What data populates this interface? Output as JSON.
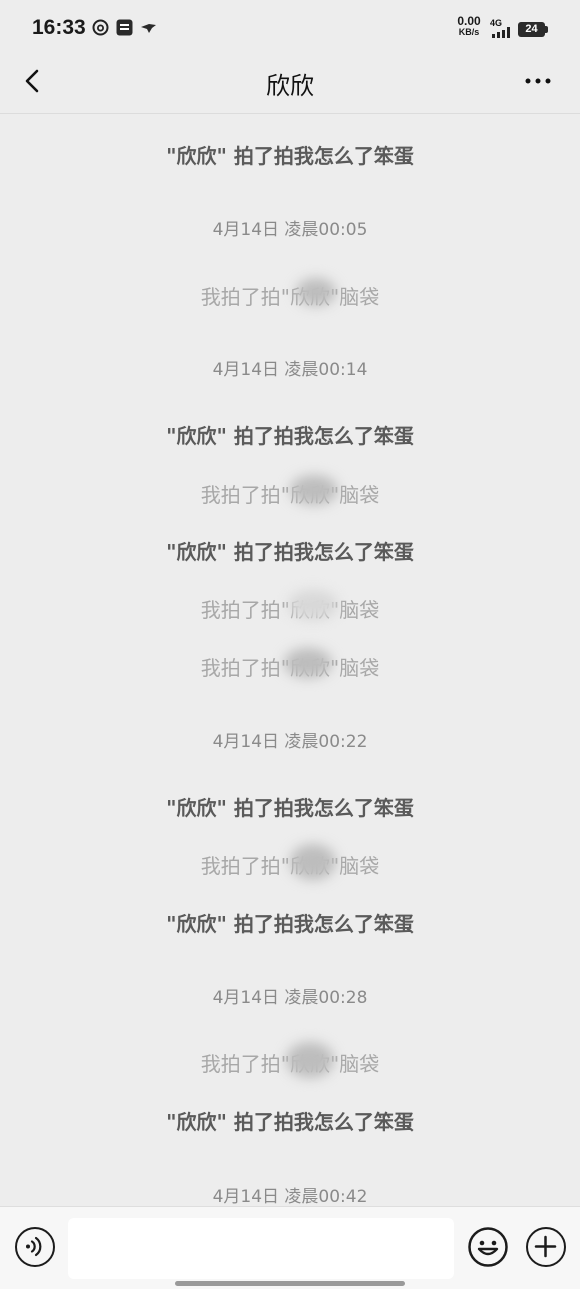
{
  "status_bar": {
    "time": "16:33",
    "net_speed_value": "0.00",
    "net_speed_unit": "KB/s",
    "network": "4G",
    "battery": "24"
  },
  "header": {
    "title": "欣欣",
    "back_icon": "chevron-left-icon",
    "more_icon": "more-dots-icon"
  },
  "messages": [
    {
      "type": "pat",
      "text": "\"欣欣\" 拍了拍我怎么了笨蛋"
    },
    {
      "type": "time",
      "text": "4月14日 凌晨00:05"
    },
    {
      "type": "self",
      "text": "我拍了拍\"欣欣\"脑袋"
    },
    {
      "type": "time",
      "text": "4月14日 凌晨00:14"
    },
    {
      "type": "pat",
      "text": "\"欣欣\" 拍了拍我怎么了笨蛋"
    },
    {
      "type": "self",
      "text": "我拍了拍\"欣欣\"脑袋"
    },
    {
      "type": "pat",
      "text": "\"欣欣\" 拍了拍我怎么了笨蛋"
    },
    {
      "type": "self",
      "text": "我拍了拍\"欣欣\"脑袋"
    },
    {
      "type": "self",
      "text": "我拍了拍\"欣欣\"脑袋"
    },
    {
      "type": "time",
      "text": "4月14日 凌晨00:22"
    },
    {
      "type": "pat",
      "text": "\"欣欣\" 拍了拍我怎么了笨蛋"
    },
    {
      "type": "self",
      "text": "我拍了拍\"欣欣\"脑袋"
    },
    {
      "type": "pat",
      "text": "\"欣欣\" 拍了拍我怎么了笨蛋"
    },
    {
      "type": "time",
      "text": "4月14日 凌晨00:28"
    },
    {
      "type": "self",
      "text": "我拍了拍\"欣欣\"脑袋"
    },
    {
      "type": "pat",
      "text": "\"欣欣\" 拍了拍我怎么了笨蛋"
    },
    {
      "type": "time",
      "text": "4月14日 凌晨00:42"
    }
  ],
  "input_bar": {
    "voice_icon": "voice-icon",
    "emoji_icon": "emoji-icon",
    "plus_icon": "plus-icon",
    "input_value": ""
  }
}
